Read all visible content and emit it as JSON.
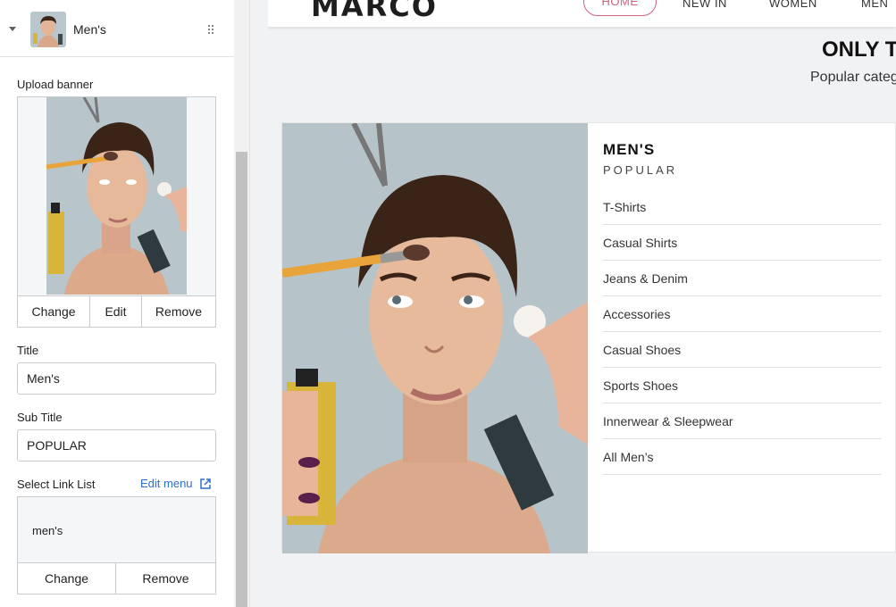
{
  "block": {
    "title": "Men's"
  },
  "fields": {
    "upload_banner_label": "Upload banner",
    "banner_buttons": {
      "change": "Change",
      "edit": "Edit",
      "remove": "Remove"
    },
    "title_label": "Title",
    "title_value": "Men's",
    "subtitle_label": "Sub Title",
    "subtitle_value": "POPULAR",
    "link_list_label": "Select Link List",
    "edit_menu_label": "Edit menu",
    "link_list_value": "men's",
    "link_buttons": {
      "change": "Change",
      "remove": "Remove"
    }
  },
  "store": {
    "logo": "MARCO",
    "nav": [
      "HOME",
      "NEW IN",
      "WOMEN",
      "MEN"
    ],
    "section_heading": "ONLY T",
    "section_sub": "Popular categ",
    "category": {
      "title": "MEN'S",
      "subtitle": "POPULAR",
      "links": [
        "T-Shirts",
        "Casual Shirts",
        "Jeans & Denim",
        "Accessories",
        "Casual Shoes",
        "Sports Shoes",
        "Innerwear & Sleepwear",
        "All Men’s"
      ]
    }
  },
  "colors": {
    "accent_pink": "#d0627b",
    "link_blue": "#2c6ecb"
  },
  "icons": {
    "caret": "caret-down-icon",
    "drag": "drag-handle-icon",
    "external": "external-link-icon"
  }
}
